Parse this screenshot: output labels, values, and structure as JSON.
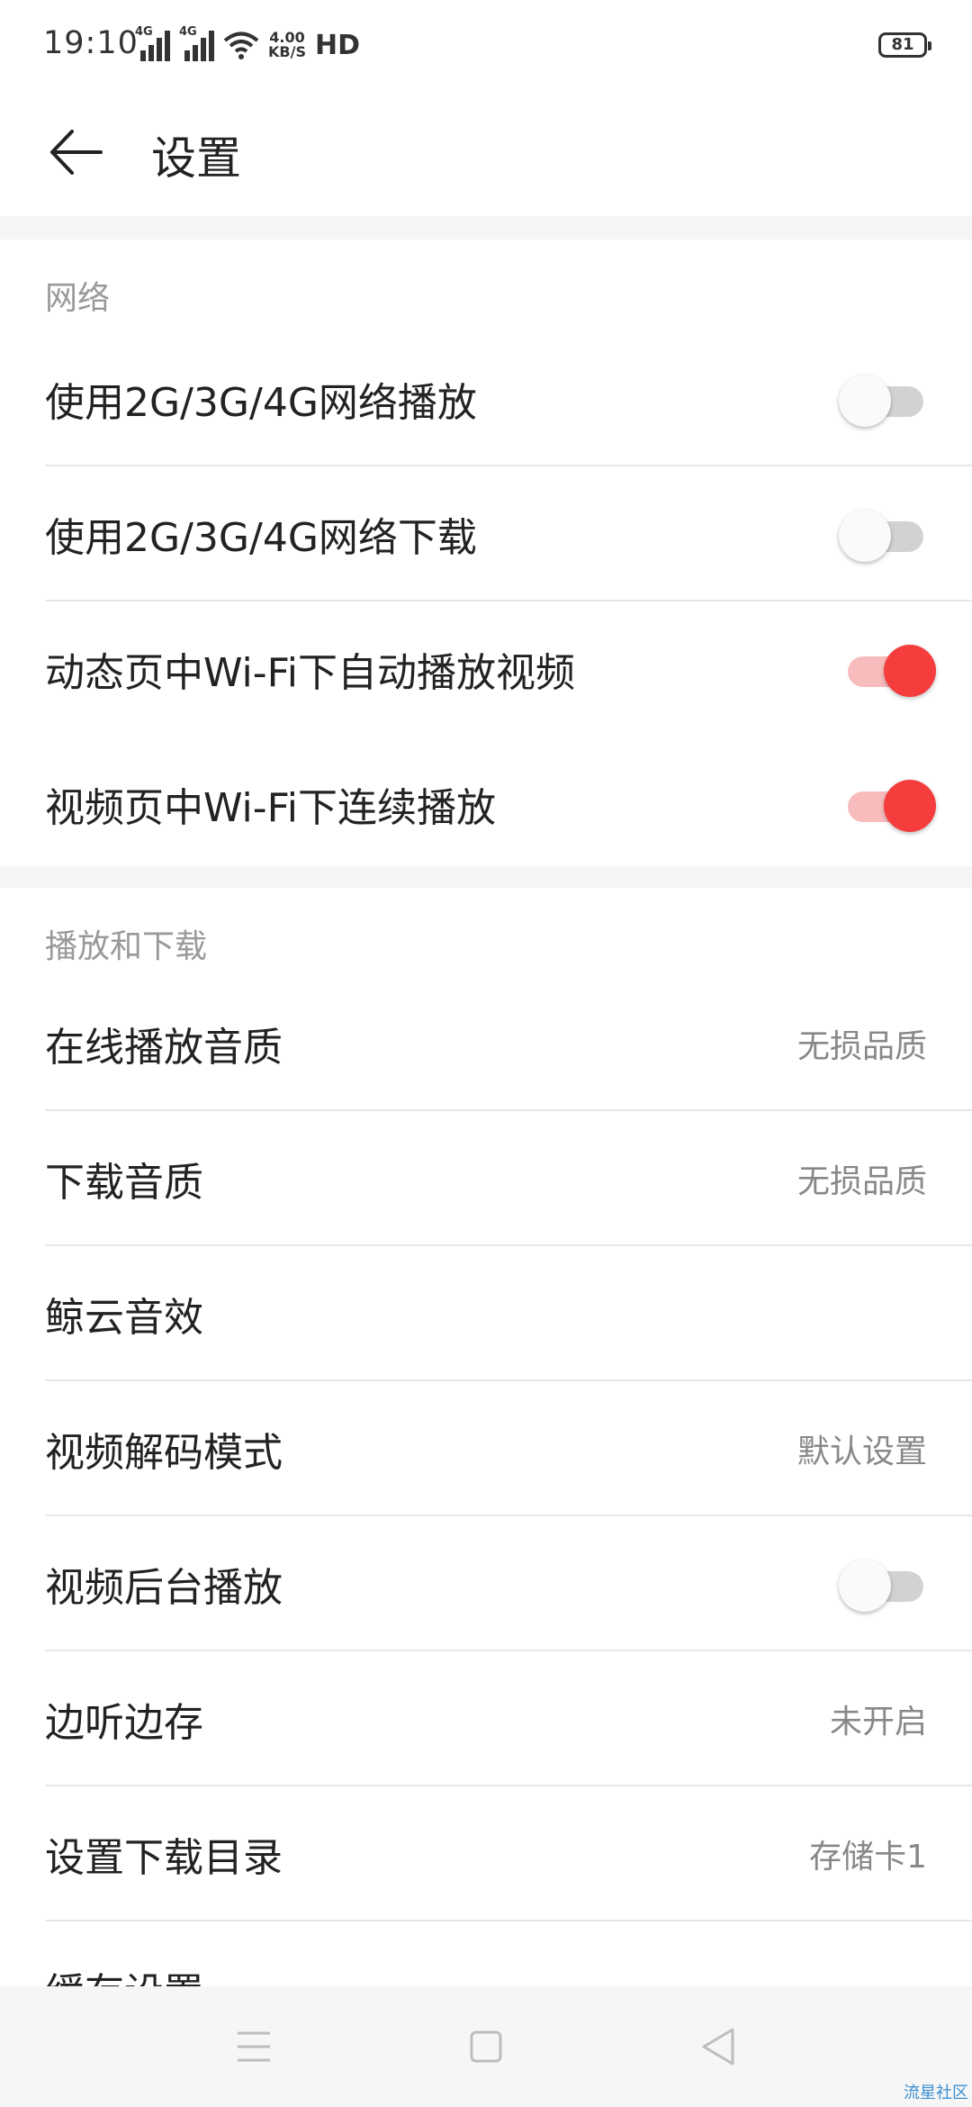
{
  "status_bar": {
    "time": "19:10",
    "network1": "4G",
    "network2": "4G",
    "speed_value": "4.00",
    "speed_unit": "KB/S",
    "hd": "HD",
    "battery": "81"
  },
  "header": {
    "title": "设置"
  },
  "network_section": {
    "title": "网络",
    "items": [
      {
        "label": "使用2G/3G/4G网络播放",
        "toggle": false
      },
      {
        "label": "使用2G/3G/4G网络下载",
        "toggle": false
      },
      {
        "label": "动态页中Wi-Fi下自动播放视频",
        "toggle": true
      },
      {
        "label": "视频页中Wi-Fi下连续播放",
        "toggle": true
      }
    ]
  },
  "play_section": {
    "title": "播放和下载",
    "items": [
      {
        "label": "在线播放音质",
        "value": "无损品质"
      },
      {
        "label": "下载音质",
        "value": "无损品质"
      },
      {
        "label": "鲸云音效",
        "value": ""
      },
      {
        "label": "视频解码模式",
        "value": "默认设置"
      },
      {
        "label": "视频后台播放",
        "toggle": false
      },
      {
        "label": "边听边存",
        "value": "未开启"
      },
      {
        "label": "设置下载目录",
        "value": "存储卡1"
      },
      {
        "label": "缓存设置",
        "value": ""
      }
    ]
  },
  "colors": {
    "accent": "#f53d3d",
    "accent_track": "#f8bcbc",
    "off_track": "#d2d2d2"
  },
  "watermark": "流星社区"
}
